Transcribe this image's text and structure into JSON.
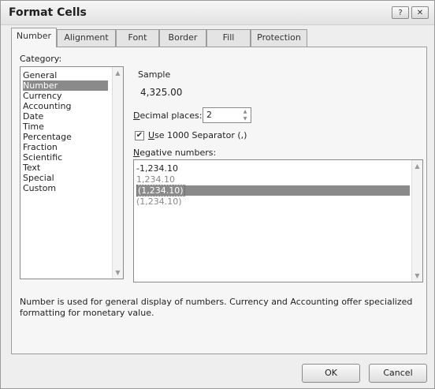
{
  "window": {
    "title": "Format Cells",
    "help_glyph": "?",
    "close_glyph": "✕"
  },
  "tabs": [
    {
      "label": "Number"
    },
    {
      "label": "Alignment"
    },
    {
      "label": "Font"
    },
    {
      "label": "Border"
    },
    {
      "label": "Fill"
    },
    {
      "label": "Protection"
    }
  ],
  "category": {
    "label": "Category:",
    "items": [
      "General",
      "Number",
      "Currency",
      "Accounting",
      "Date",
      "Time",
      "Percentage",
      "Fraction",
      "Scientific",
      "Text",
      "Special",
      "Custom"
    ],
    "selected": "Number"
  },
  "sample": {
    "label": "Sample",
    "value": "4,325.00"
  },
  "decimal_places": {
    "label": "Decimal places:",
    "value": "2"
  },
  "separator": {
    "label": "Use 1000 Separator (,)",
    "checked": true,
    "check_glyph": "✔"
  },
  "negative": {
    "label": "Negative numbers:",
    "items": [
      "-1,234.10",
      "1,234.10",
      "(1,234.10)",
      "(1,234.10)"
    ],
    "selected_index": 2
  },
  "description": "Number is used for general display of numbers.  Currency and Accounting offer specialized formatting for monetary value.",
  "buttons": {
    "ok": "OK",
    "cancel": "Cancel"
  },
  "scroll_glyphs": {
    "up": "▲",
    "down": "▼"
  },
  "colors": {
    "selection": "#8a8a8a",
    "negative_red": "#888888"
  }
}
